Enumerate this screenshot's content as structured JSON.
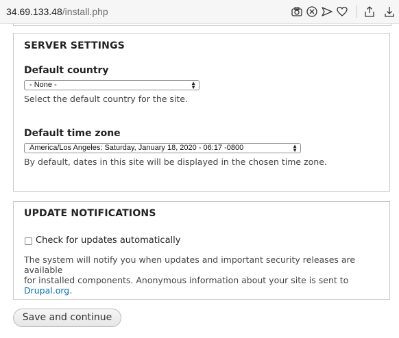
{
  "browser": {
    "url_host": "34.69.133.48",
    "url_path": "/install.php",
    "icons": [
      "camera-icon",
      "close-circle-icon",
      "send-icon",
      "heart-icon",
      "share-icon",
      "download-icon"
    ]
  },
  "server_settings": {
    "legend": "SERVER SETTINGS",
    "country": {
      "label": "Default country",
      "selected": "- None -",
      "description": "Select the default country for the site."
    },
    "timezone": {
      "label": "Default time zone",
      "selected": "America/Los Angeles: Saturday, January 18, 2020 - 06:17 -0800",
      "description": "By default, dates in this site will be displayed in the chosen time zone."
    }
  },
  "update_notifications": {
    "legend": "UPDATE NOTIFICATIONS",
    "checkbox_label": "Check for updates automatically",
    "checkbox_checked": false,
    "description_line1": "The system will notify you when updates and important security releases are available",
    "description_line2": "for installed components. Anonymous information about your site is sent to",
    "link_text": "Drupal.org",
    "description_end": "."
  },
  "actions": {
    "submit_label": "Save and continue"
  },
  "colors": {
    "link": "#0071b3",
    "border": "#c9c9c9"
  }
}
